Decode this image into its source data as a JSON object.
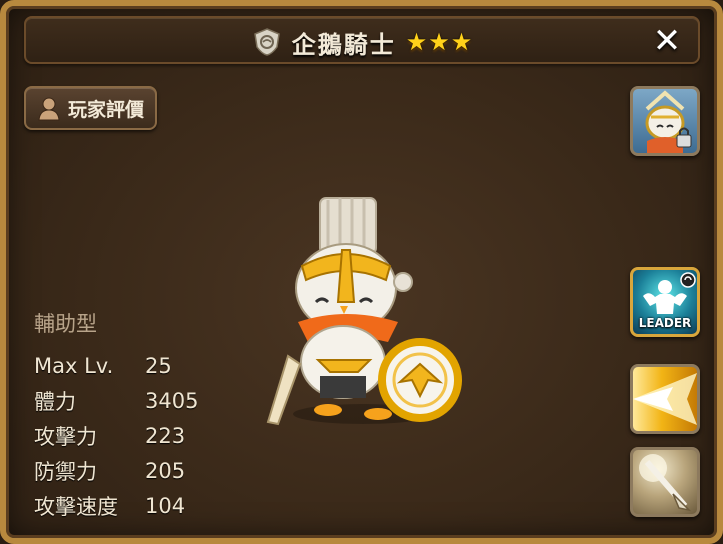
{
  "title": {
    "name": "企鵝騎士",
    "stars": [
      "★",
      "★",
      "★"
    ],
    "close_label": "✕"
  },
  "rating_button": {
    "label": "玩家評價"
  },
  "side_buttons": {
    "leader_label": "LEADER"
  },
  "stats": {
    "type": "輔助型",
    "rows": [
      {
        "label": "Max Lv.",
        "value": "25"
      },
      {
        "label": "體力",
        "value": "3405"
      },
      {
        "label": "攻擊力",
        "value": "223"
      },
      {
        "label": "防禦力",
        "value": "205"
      },
      {
        "label": "攻擊速度",
        "value": "104"
      }
    ]
  },
  "colors": {
    "frame": "#b8893e",
    "star": "#ffd21a",
    "text": "#f0e6d2",
    "type_text": "#b8a48a",
    "leader_border": "#d8a63c"
  },
  "icons": {
    "element": "wind-element-icon",
    "rating": "person-icon",
    "portrait": "locked-portrait-icon",
    "leader": "leader-skill-icon",
    "skill1": "light-burst-skill-icon",
    "skill2": "spear-skill-icon"
  }
}
